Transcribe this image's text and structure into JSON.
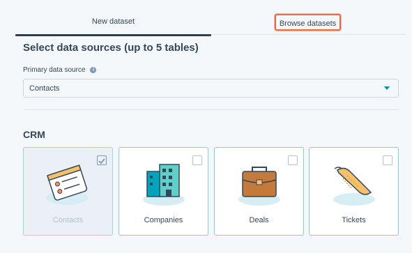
{
  "tabs": {
    "new_dataset": "New dataset",
    "browse_datasets": "Browse datasets"
  },
  "title": "Select data sources (up to 5 tables)",
  "primary_source": {
    "label": "Primary data source",
    "info_icon": "info-icon",
    "value": "Contacts"
  },
  "crm": {
    "title": "CRM",
    "cards": [
      {
        "label": "Contacts",
        "icon": "contacts-card-icon",
        "checked": true
      },
      {
        "label": "Companies",
        "icon": "building-icon",
        "checked": false
      },
      {
        "label": "Deals",
        "icon": "briefcase-icon",
        "checked": false
      },
      {
        "label": "Tickets",
        "icon": "ticket-icon",
        "checked": false
      }
    ]
  },
  "colors": {
    "accent_border": "#7fd1de",
    "highlight": "#e8694a",
    "text": "#33475b",
    "tab_underline": "#2d3e50"
  }
}
